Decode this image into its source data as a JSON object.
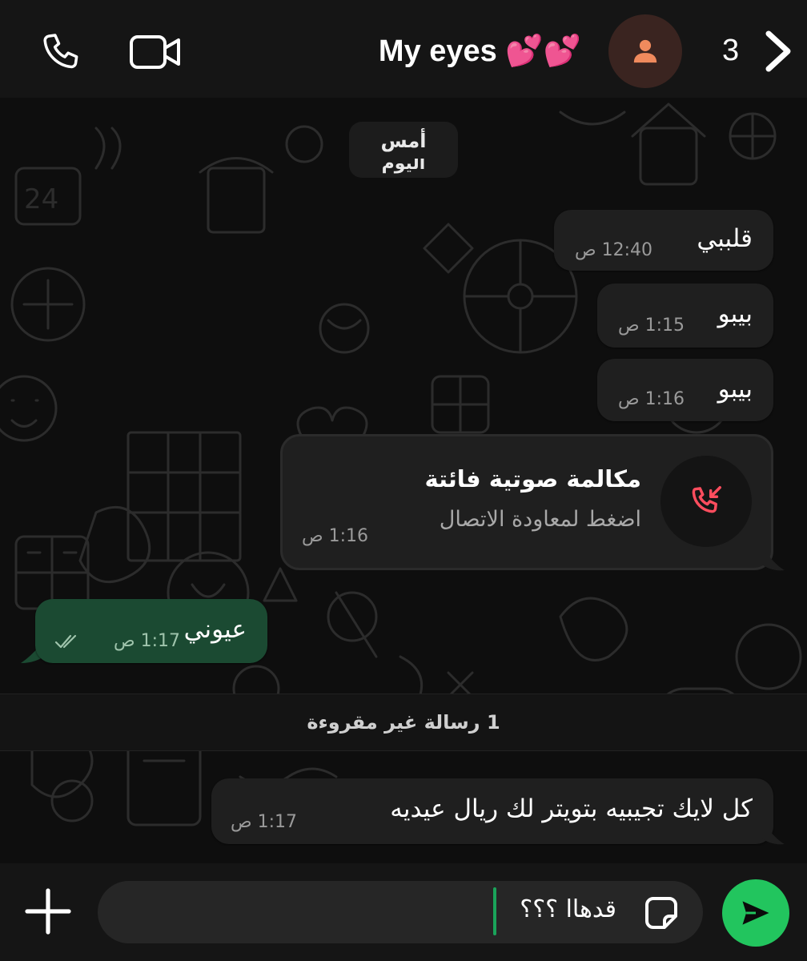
{
  "header": {
    "title": "My eyes 💕💕",
    "count": "3",
    "icons": {
      "call": "phone-icon",
      "video": "video-camera-icon",
      "avatar": "person-icon",
      "next": "chevron-right-icon"
    }
  },
  "chat": {
    "date_chip": {
      "primary": "أمس",
      "secondary": "اليوم"
    },
    "messages": [
      {
        "text": "قلببي",
        "time": "12:40 ص",
        "direction": "incoming"
      },
      {
        "text": "بيبو",
        "time": "1:15 ص",
        "direction": "incoming"
      },
      {
        "text": "بيبو",
        "time": "1:16 ص",
        "direction": "incoming"
      },
      {
        "text": "عيوني",
        "time": "1:17 ص",
        "direction": "outgoing",
        "status": "read"
      }
    ],
    "missed_call": {
      "title": "مكالمة صوتية فائتة",
      "subtitle": "اضغط لمعاودة الاتصال",
      "time": "1:16 ص",
      "icon": "missed-call-icon",
      "accent": "#ff4d5e"
    },
    "unread_banner": "1 رسالة غير مقروءة",
    "last_message": {
      "text": "كل لايك تجيبيه بتويتر لك ريال عيديه",
      "time": "1:17 ص",
      "direction": "incoming"
    }
  },
  "composer": {
    "value": "قدهاا ؟؟؟",
    "icons": {
      "attach": "plus-icon",
      "sticker": "sticker-icon",
      "send": "send-icon"
    }
  },
  "colors": {
    "header_bg": "#151515",
    "incoming_bubble": "#1f1f1f",
    "outgoing_bubble": "#1b4a32",
    "send_button": "#22c55e",
    "avatar_bg": "#3a2420",
    "avatar_icon": "#f08a5d"
  }
}
